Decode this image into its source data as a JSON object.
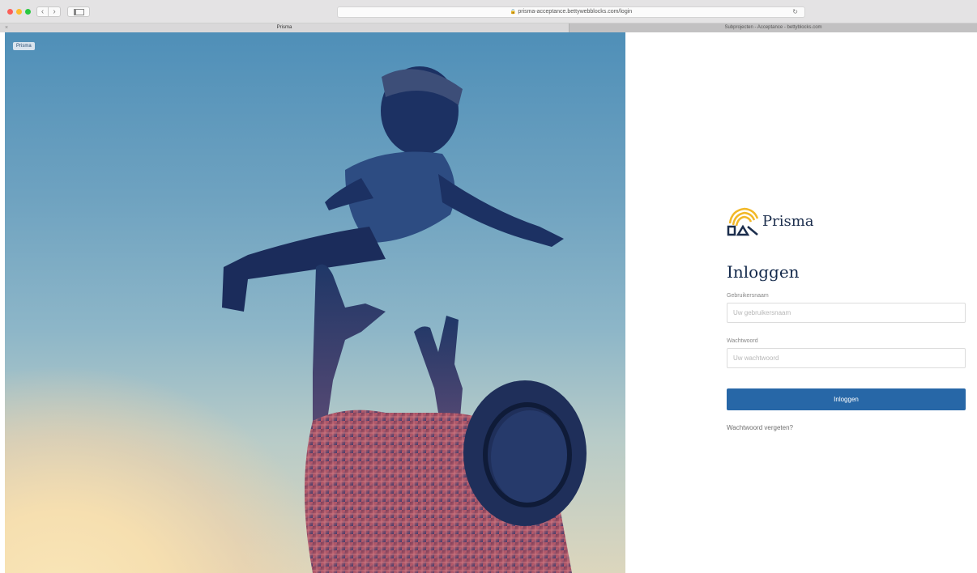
{
  "browser": {
    "url": "prisma-acceptance.bettywebblocks.com/login",
    "tabs": [
      {
        "label": "Prisma",
        "active": true
      },
      {
        "label": "Subprojecten - Acceptance - bettyblocks.com",
        "active": false
      }
    ],
    "tab_close_glyph": "×",
    "nav_back_glyph": "‹",
    "nav_forward_glyph": "›",
    "reload_glyph": "↻",
    "lock_glyph": "🔒"
  },
  "app_badge": "Prisma",
  "login": {
    "logo_text": "Prisma",
    "title": "Inloggen",
    "username_label": "Gebruikersnaam",
    "username_placeholder": "Uw gebruikersnaam",
    "password_label": "Wachtwoord",
    "password_placeholder": "Uw wachtwoord",
    "submit_label": "Inloggen",
    "forgot_link": "Wachtwoord vergeten?"
  },
  "colors": {
    "primary": "#2767a7",
    "heading": "#13294b",
    "logo_gold": "#f2b827",
    "logo_navy": "#1b2d4c"
  },
  "icons": [
    "lock-icon",
    "reload-icon",
    "sidebar-icon",
    "back-icon",
    "forward-icon",
    "close-icon",
    "prisma-logo-icon"
  ]
}
